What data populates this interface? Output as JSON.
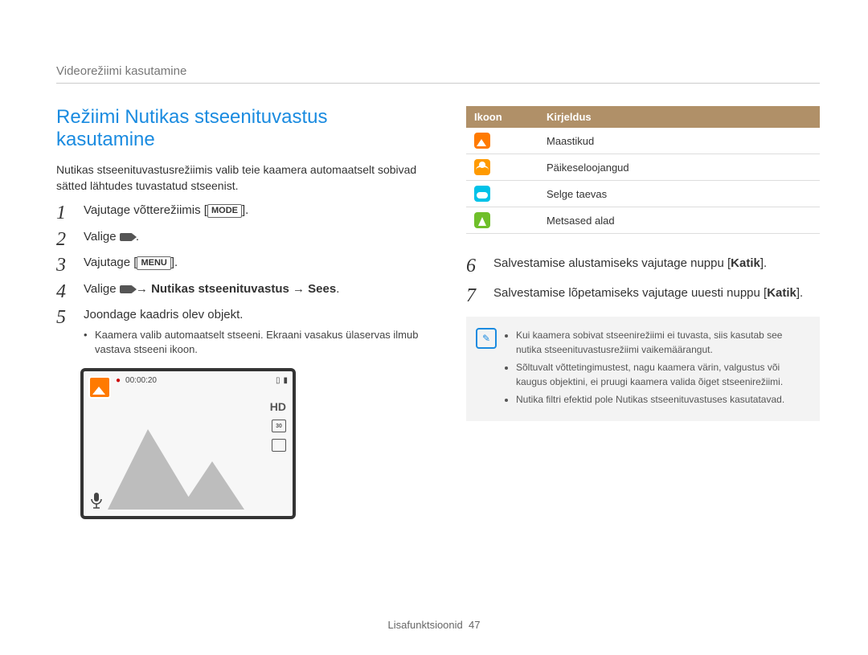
{
  "breadcrumb": "Videorežiimi kasutamine",
  "title": "Režiimi Nutikas stseenituvastus kasutamine",
  "intro": "Nutikas stseenituvastusrežiimis valib teie kaamera automaatselt sobivad sätted lähtudes tuvastatud stseenist.",
  "steps_left": [
    {
      "prefix": "Vajutage võtterežiimis [",
      "badge": "MODE",
      "suffix": "]."
    },
    {
      "prefix": "Valige ",
      "video_icon": true,
      "suffix": " ."
    },
    {
      "prefix": "Vajutage [",
      "badge": "MENU",
      "suffix": "]."
    },
    {
      "prefix": "Valige ",
      "video_icon": true,
      "bold": " → Nutikas stseenituvastus → Sees",
      "suffix": "."
    },
    {
      "prefix": "Joondage kaadris olev objekt.",
      "sub": "Kaamera valib automaatselt stseeni. Ekraani vasakus ülaservas ilmub vastava stseeni ikoon."
    }
  ],
  "preview": {
    "rec_dot": "●",
    "time": "00:00:20",
    "hd": "HD",
    "q30": "30"
  },
  "icon_table": {
    "headers": [
      "Ikoon",
      "Kirjeldus"
    ],
    "rows": [
      {
        "icon": "landscape",
        "desc": "Maastikud"
      },
      {
        "icon": "sunset",
        "desc": "Päikeseloojangud"
      },
      {
        "icon": "sky",
        "desc": "Selge taevas"
      },
      {
        "icon": "forest",
        "desc": "Metsased alad"
      }
    ]
  },
  "steps_right": [
    {
      "num": "6",
      "prefix": "Salvestamise alustamiseks vajutage nuppu [",
      "bold": "Katik",
      "suffix": "]."
    },
    {
      "num": "7",
      "prefix": "Salvestamise lõpetamiseks vajutage uuesti nuppu [",
      "bold": "Katik",
      "suffix": "]."
    }
  ],
  "notes": [
    "Kui kaamera sobivat stseenirežiimi ei tuvasta, siis kasutab see nutika stseenituvastusrežiimi vaikemäärangut.",
    "Sõltuvalt võttetingimustest, nagu kaamera värin, valgustus või kaugus objektini, ei pruugi kaamera valida õiget stseenirežiimi.",
    "Nutika filtri efektid pole Nutikas stseenituvastuses kasutatavad."
  ],
  "footer": {
    "section": "Lisafunktsioonid",
    "page": "47"
  }
}
